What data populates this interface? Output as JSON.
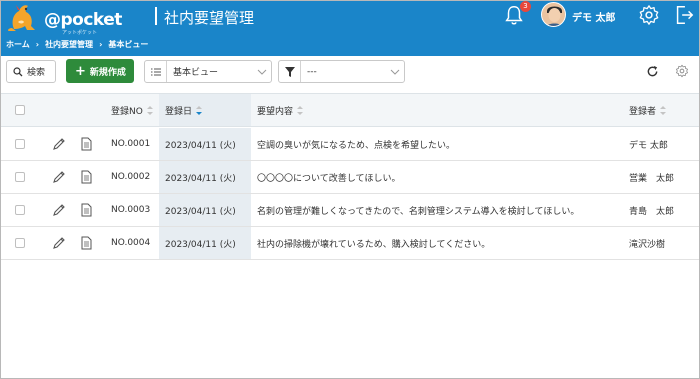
{
  "header": {
    "logo_text": "@pocket",
    "logo_subtext": "アットポケット",
    "app_title": "社内要望管理",
    "notification_count": "3",
    "user_name": "デモ 太郎"
  },
  "breadcrumb": [
    "ホーム",
    "社内要望管理",
    "基本ビュー"
  ],
  "toolbar": {
    "search_label": "検索",
    "new_label": "新規作成",
    "view_select": "基本ビュー",
    "filter_select": "---"
  },
  "table": {
    "columns": {
      "no": "登録NO",
      "date": "登録日",
      "request": "要望内容",
      "user": "登録者"
    },
    "rows": [
      {
        "no": "NO.0001",
        "date": "2023/04/11 (火)",
        "request": "空調の臭いが気になるため、点検を希望したい。",
        "user": "デモ 太郎"
      },
      {
        "no": "NO.0002",
        "date": "2023/04/11 (火)",
        "request": "〇〇〇〇について改善してほしい。",
        "user": "営業　太郎"
      },
      {
        "no": "NO.0003",
        "date": "2023/04/11 (火)",
        "request": "名刺の管理が難しくなってきたので、名刺管理システム導入を検討してほしい。",
        "user": "青島　太郎"
      },
      {
        "no": "NO.0004",
        "date": "2023/04/11 (火)",
        "request": "社内の掃除機が壊れているため、購入検討してください。",
        "user": "滝沢沙樹"
      }
    ]
  },
  "colors": {
    "header_bg": "#1a85c9",
    "new_button": "#2e8b3b",
    "badge": "#e8473b"
  },
  "icons": [
    "kangaroo-logo",
    "bell-icon",
    "gear-icon",
    "logout-icon",
    "search-icon",
    "plus-icon",
    "list-icon",
    "filter-icon",
    "chevron-down-icon",
    "reload-icon",
    "pencil-icon",
    "document-icon",
    "sort-icon"
  ]
}
